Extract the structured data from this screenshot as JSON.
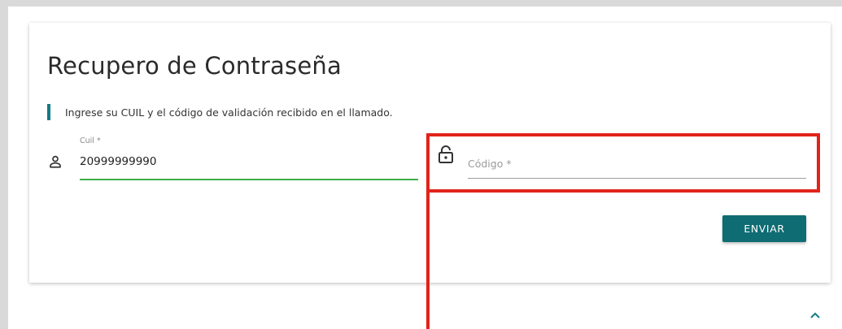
{
  "page": {
    "title": "Recupero de Contraseña",
    "info_text": "Ingrese su CUIL y el código de validación recibido en el llamado."
  },
  "form": {
    "cuil": {
      "label": "Cuil *",
      "value": "20999999990",
      "icon": "person-icon"
    },
    "codigo": {
      "placeholder": "Código *",
      "value": "",
      "icon": "lock-open-icon"
    },
    "submit_label": "ENVIAR"
  },
  "colors": {
    "accent_bar": "#127b86",
    "button": "#0f6c73",
    "active_underline": "#3fae49",
    "highlight": "#e2231a"
  },
  "scroll_icon": "chevron-up-icon"
}
